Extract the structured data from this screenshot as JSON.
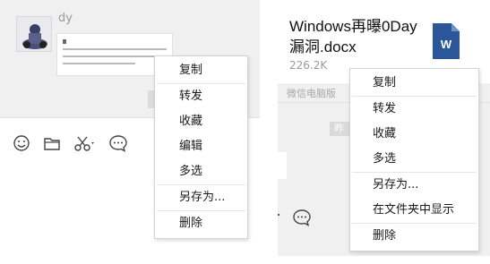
{
  "left": {
    "sender_name": "dy",
    "menu": {
      "items": [
        "复制",
        "转发",
        "收藏",
        "编辑",
        "多选",
        "另存为...",
        "删除"
      ],
      "separators_after": [
        0,
        4,
        5
      ]
    },
    "toolbar_icons": [
      "emoji-icon",
      "folder-icon",
      "scissors-icon",
      "chat-bubble-icon"
    ]
  },
  "right": {
    "file": {
      "name": "Windows再曝0Day漏洞.docx",
      "size": "226.2K",
      "icon_letter": "W"
    },
    "source_label": "微信电脑版",
    "chip_text": "昨",
    "menu": {
      "items": [
        "复制",
        "转发",
        "收藏",
        "多选",
        "另存为...",
        "在文件夹中显示",
        "删除"
      ],
      "separators_after": [
        0,
        3,
        5
      ]
    }
  },
  "colors": {
    "panel_bg": "#f0f0f0",
    "menu_bg": "#ffffff",
    "word_blue": "#2b579a"
  }
}
